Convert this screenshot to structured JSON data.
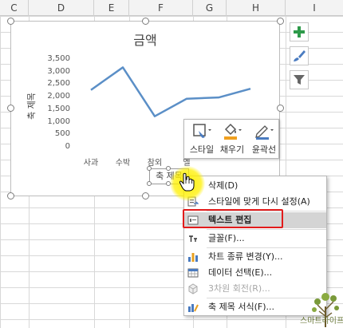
{
  "columns": [
    "C",
    "D",
    "E",
    "F",
    "G",
    "H",
    "I"
  ],
  "chart": {
    "title": "금액",
    "y_axis_title": "축 제목",
    "x_axis_title_box": "축 제목",
    "line_color": "#5b8fc7"
  },
  "chart_data": {
    "type": "line",
    "title": "금액",
    "ylabel": "축 제목",
    "categories": [
      "사과",
      "수박",
      "참외",
      "멜론",
      "",
      ""
    ],
    "values": [
      2300,
      3200,
      1250,
      1950,
      2000,
      2350
    ],
    "ylim": [
      0,
      3500
    ],
    "yticks": [
      "3,500",
      "3,000",
      "2,500",
      "2,000",
      "1,500",
      "1,000",
      "500",
      "0"
    ],
    "xtick_labels": [
      "사과",
      "수박",
      "참외",
      "멜"
    ],
    "grid": false
  },
  "side_buttons": [
    {
      "name": "chart-elements-button",
      "icon": "plus-icon"
    },
    {
      "name": "chart-styles-button",
      "icon": "brush-icon"
    },
    {
      "name": "chart-filters-button",
      "icon": "filter-icon"
    }
  ],
  "mini_toolbar": {
    "style": "스타일",
    "fill": "채우기",
    "outline": "윤곽선"
  },
  "context_menu": {
    "delete": "삭제(D)",
    "reset_style": "스타일에 맞게 다시 설정(A)",
    "edit_text": "텍스트 편집",
    "font": "글꼴(F)...",
    "change_chart_type": "차트 종류 변경(Y)...",
    "select_data": "데이터 선택(E)...",
    "rotate_3d": "3차원 회전(R)...",
    "format_axis_title": "축 제목 서식(F)..."
  },
  "watermark": "스마트라이프"
}
